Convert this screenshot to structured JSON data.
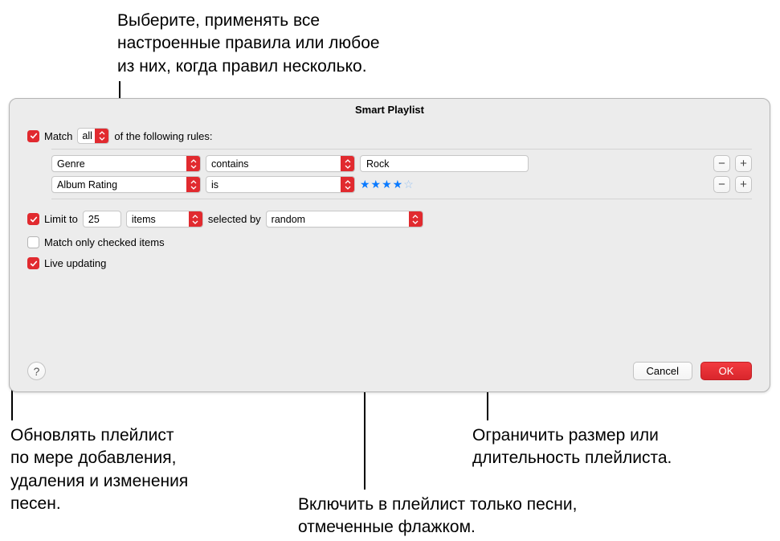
{
  "callouts": {
    "top": "Выберите, применять все\nнастроенные правила или любое\nиз них, когда правил несколько.",
    "bottom_left": "Обновлять плейлист\nпо мере добавления,\nудаления и изменения\nпесен.",
    "bottom_mid": "Включить в плейлист только песни,\nотмеченные флажком.",
    "bottom_right": "Ограничить размер или\nдлительность плейлиста."
  },
  "dialog": {
    "title": "Smart Playlist",
    "match_label_before": "Match",
    "match_mode": "all",
    "match_label_after": "of the following rules:",
    "rules": [
      {
        "field": "Genre",
        "op": "contains",
        "value": "Rock",
        "type": "text"
      },
      {
        "field": "Album Rating",
        "op": "is",
        "value": 4,
        "type": "stars"
      }
    ],
    "minus": "−",
    "plus": "+",
    "limit": {
      "label": "Limit to",
      "count": "25",
      "unit": "items",
      "mid": "selected by",
      "by": "random"
    },
    "match_checked_label": "Match only checked items",
    "live_label": "Live updating",
    "help": "?",
    "cancel": "Cancel",
    "ok": "OK"
  }
}
